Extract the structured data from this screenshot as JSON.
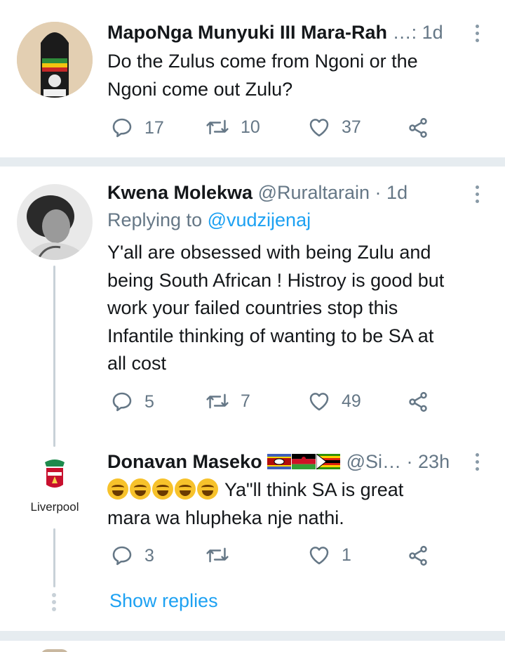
{
  "tweets": [
    {
      "name": "MapoNga Munyuki III Mara-Rah",
      "handle": "…",
      "sep": ": ",
      "time": "1d",
      "lines": [
        "Do the Zulus come from Ngoni or the",
        "Ngoni come out Zulu?"
      ],
      "replies": "17",
      "retweets": "10",
      "likes": "37"
    },
    {
      "name": "Kwena Molekwa",
      "handle": "@Ruraltarain",
      "sep": " · ",
      "time": "1d",
      "replying_label": "Replying to ",
      "replying_handle": "@vudzijenaj",
      "lines": [
        "Y'all are obsessed with being Zulu and",
        "being South African ! Histroy is good but",
        "work your failed countries stop this",
        "Infantile thinking of wanting to be SA at",
        "all cost"
      ],
      "replies": "5",
      "retweets": "7",
      "likes": "49"
    },
    {
      "name": "Donavan Maseko",
      "handle": "@Si…",
      "sep": " · ",
      "time": "23h",
      "avatar_caption": "Liverpool",
      "line1_text": "Ya\"ll think SA is great",
      "line2_text": "mara wa hlupheka nje nathi.",
      "replies": "3",
      "retweets": "",
      "likes": "1"
    }
  ],
  "show_replies": "Show replies",
  "colors": {
    "accent": "#1da1f2",
    "secondary_text": "#657786",
    "divider": "#e6ecf0"
  }
}
